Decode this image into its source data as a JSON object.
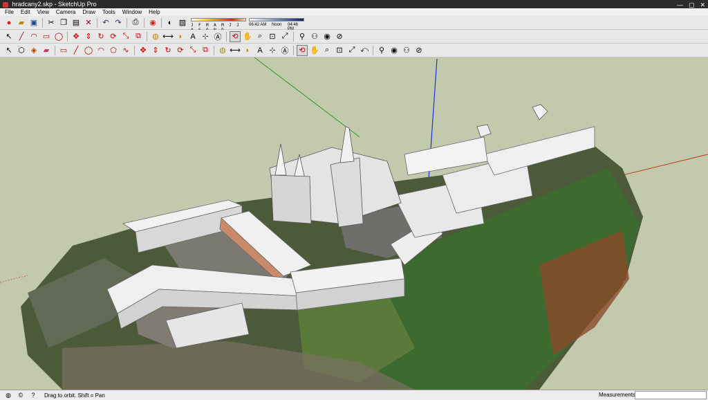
{
  "window": {
    "title": "hradcany2.skp - SketchUp Pro",
    "minimize": "—",
    "maximize": "▢",
    "close": "✕"
  },
  "menu": [
    "File",
    "Edit",
    "View",
    "Camera",
    "Draw",
    "Tools",
    "Window",
    "Help"
  ],
  "shadow": {
    "months": "J F M A M J J A S O N D",
    "time_start": "06:42 AM",
    "time_mid": "Noon",
    "time_end": "04:46 PM"
  },
  "status": {
    "hint": "Drag to orbit.  Shift = Pan",
    "measurements_label": "Measurements",
    "measurements_value": ""
  },
  "toolbar1": [
    "sketchup-icon",
    "open-icon",
    "save-icon",
    "cut-icon",
    "copy-icon",
    "paste-icon",
    "erase-icon",
    "undo-icon",
    "redo-icon",
    "print-icon",
    "model-info-icon"
  ],
  "toolbar2": [
    "select-icon",
    "line-icon",
    "arc-icon",
    "rectangle-icon",
    "circle-icon",
    "move-icon",
    "pushpull-icon",
    "rotate-icon",
    "followme-icon",
    "scale-icon",
    "offset-icon",
    "tape-icon",
    "dimension-icon",
    "protractor-icon",
    "text-icon",
    "axes-icon",
    "3dtext-icon",
    "orbit-icon",
    "pan-icon",
    "zoom-icon",
    "zoom-window-icon",
    "zoom-extents-icon",
    "position-camera-icon",
    "walk-icon",
    "lookaround-icon",
    "section-icon"
  ],
  "toolbar3": [
    "select-icon",
    "component-icon",
    "paint-icon",
    "eraser-icon",
    "rectangle-icon",
    "line-icon",
    "circle-icon",
    "arc-icon",
    "polygon-icon",
    "freehand-icon",
    "move-icon",
    "pushpull-icon",
    "rotate-icon",
    "followme-icon",
    "scale-icon",
    "offset-icon",
    "tape-icon",
    "dimension-icon",
    "protractor-icon",
    "axes-icon",
    "text-icon",
    "3dtext-icon",
    "orbit-icon",
    "pan-icon",
    "zoom-icon",
    "zoom-window-icon",
    "zoom-extents-icon",
    "previous-icon",
    "position-camera-icon",
    "lookaround-icon",
    "walk-icon",
    "section-icon"
  ]
}
